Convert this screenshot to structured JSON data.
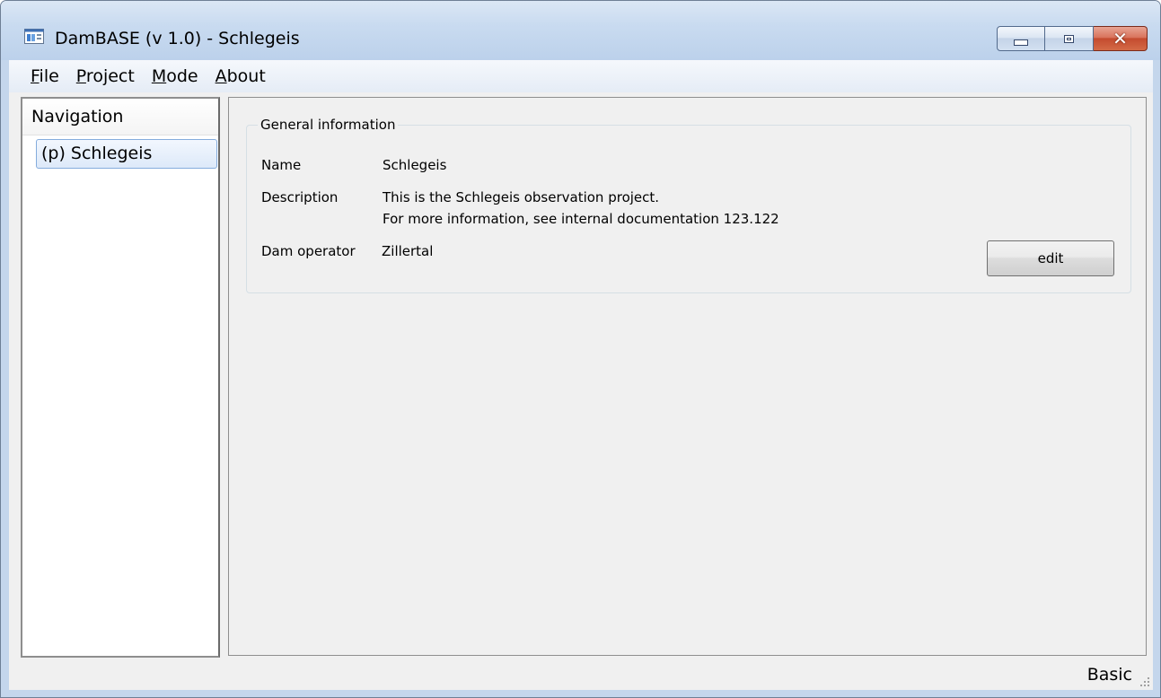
{
  "window": {
    "title": "DamBASE (v 1.0) - Schlegeis",
    "icon": "app-window-icon",
    "controls": {
      "minimize_icon": "minimize-icon",
      "maximize_icon": "maximize-icon",
      "close_icon": "close-icon",
      "close_glyph": "✕"
    }
  },
  "menu": {
    "items": [
      {
        "mnemonic": "F",
        "rest": "ile"
      },
      {
        "mnemonic": "P",
        "rest": "roject"
      },
      {
        "mnemonic": "M",
        "rest": "ode"
      },
      {
        "mnemonic": "A",
        "rest": "bout"
      }
    ]
  },
  "navigation": {
    "header": "Navigation",
    "items": [
      {
        "label": "(p) Schlegeis",
        "selected": true
      }
    ]
  },
  "general_info": {
    "title": "General information",
    "name_label": "Name",
    "name_value": "Schlegeis",
    "description_label": "Description",
    "description_line1": "This is the Schlegeis observation project.",
    "description_line2": "For more information, see internal documentation 123.122",
    "operator_label": "Dam operator",
    "operator_value": "Zillertal",
    "edit_label": "edit"
  },
  "status": {
    "mode_text": "Basic"
  },
  "colors": {
    "selection_border": "#84acdd",
    "close_button": "#c44b2f"
  }
}
